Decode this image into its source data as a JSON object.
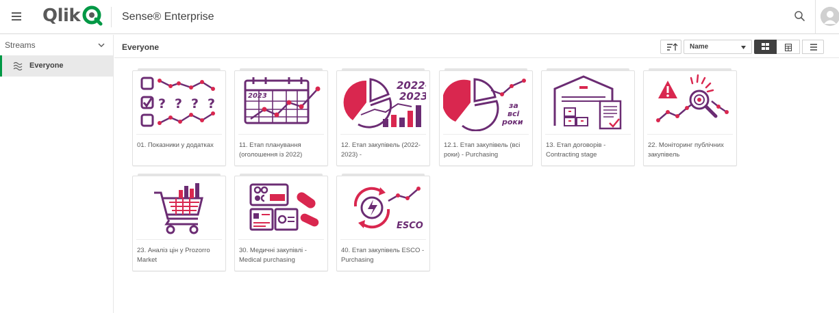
{
  "header": {
    "logo_text": "Qlik",
    "app_title": "Sense® Enterprise"
  },
  "sidebar": {
    "streams_label": "Streams",
    "items": [
      {
        "label": "Everyone",
        "active": true
      }
    ]
  },
  "main": {
    "section_title": "Everyone",
    "sort": {
      "selected": "Name"
    },
    "view_mode": "grid"
  },
  "apps": [
    {
      "title": "01. Показники у додатках",
      "icon": "checklist-questions-icon"
    },
    {
      "title": "11. Етап планування (оголошення із 2022)",
      "icon": "calendar-2023-trend-icon"
    },
    {
      "title": "12. Етап закупівель (2022-2023) -",
      "icon": "pie-bar-2022-2023-icon"
    },
    {
      "title": "12.1. Етап закупівель (всі роки) - Purchasing",
      "icon": "pie-all-years-icon"
    },
    {
      "title": "13. Етап договорів - Contracting stage",
      "icon": "warehouse-document-icon"
    },
    {
      "title": "22. Моніторинг публічних закупівель",
      "icon": "alert-magnifier-icon"
    },
    {
      "title": "23. Аналіз цін у Prozorro Market",
      "icon": "shopping-cart-chart-icon"
    },
    {
      "title": "30. Медичні закупівлі - Medical purchasing",
      "icon": "medicine-pills-icon"
    },
    {
      "title": "40. Етап закупівель ESCO - Purchasing",
      "icon": "esco-energy-cycle-icon"
    }
  ],
  "thumb_text": {
    "calendar_year": "2023",
    "years_range_top": "2022-",
    "years_range_bottom": "2023",
    "all_years_1": "за",
    "all_years_2": "всі",
    "all_years_3": "роки",
    "esco": "ESCO",
    "question_mark": "?"
  },
  "colors": {
    "purple": "#6b2c73",
    "red": "#d9274f",
    "accent_green": "#009845"
  }
}
